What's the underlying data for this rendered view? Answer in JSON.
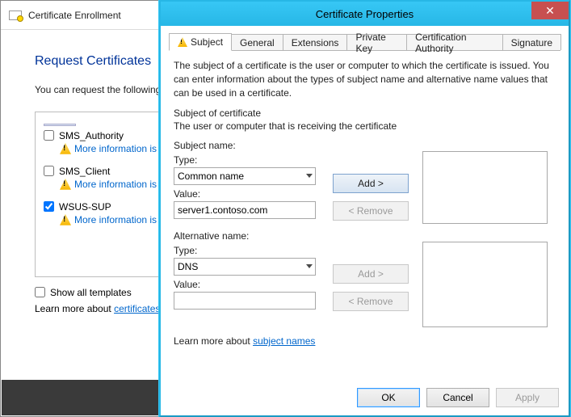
{
  "bg": {
    "title": "Certificate Enrollment",
    "heading": "Request Certificates",
    "intro": "You can request the following types of certificates. Select the certificates you want to request, and then click Enroll.",
    "cert1": {
      "label": "SMS_Authority",
      "detail": "More information is required to enroll"
    },
    "cert2": {
      "label": "SMS_Client",
      "detail": "More information is required to enroll"
    },
    "cert3": {
      "label": "WSUS-SUP",
      "detail": "More information is required to enroll"
    },
    "show_all": "Show all templates",
    "learn_pre": "Learn more about ",
    "learn_link": "certificates"
  },
  "fg": {
    "title": "Certificate Properties",
    "tabs": {
      "subject": "Subject",
      "general": "General",
      "extensions": "Extensions",
      "private_key": "Private Key",
      "ca": "Certification Authority",
      "signature": "Signature"
    },
    "desc": "The subject of a certificate is the user or computer to which the certificate is issued. You can enter information about the types of subject name and alternative name values that can be used in a certificate.",
    "sec_title": "Subject of certificate",
    "sec_sub": "The user or computer that is receiving the certificate",
    "subject": {
      "header": "Subject name:",
      "type_label": "Type:",
      "type_value": "Common name",
      "value_label": "Value:",
      "value": "server1.contoso.com",
      "add": "Add >",
      "remove": "< Remove"
    },
    "alt": {
      "header": "Alternative name:",
      "type_label": "Type:",
      "type_value": "DNS",
      "value_label": "Value:",
      "value": "",
      "add": "Add >",
      "remove": "< Remove"
    },
    "learn_pre": "Learn more about ",
    "learn_link": "subject names",
    "ok": "OK",
    "cancel": "Cancel",
    "apply": "Apply"
  }
}
